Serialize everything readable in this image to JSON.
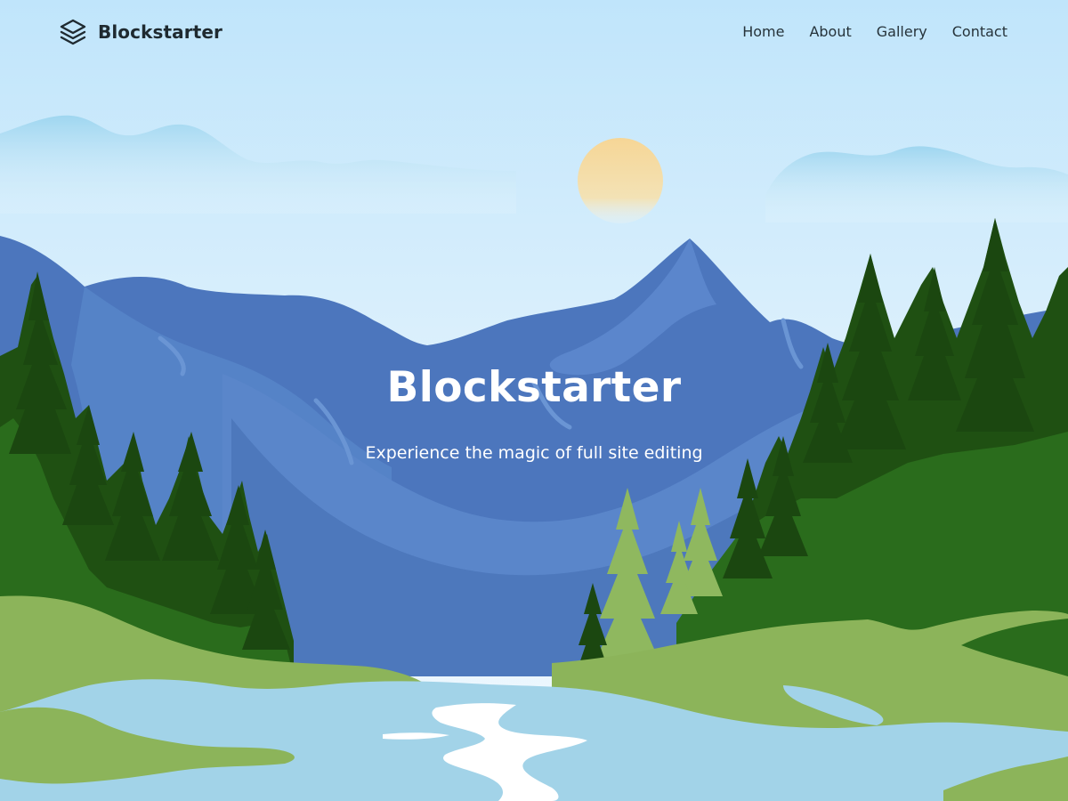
{
  "site": {
    "name": "Blockstarter",
    "logo_icon": "stacked-layers-icon"
  },
  "nav": {
    "items": [
      {
        "label": "Home"
      },
      {
        "label": "About"
      },
      {
        "label": "Gallery"
      },
      {
        "label": "Contact"
      }
    ]
  },
  "hero": {
    "title": "Blockstarter",
    "subtitle": "Experience the magic of full site editing",
    "illustration": "mountain-lake-forest-landscape"
  },
  "colors": {
    "sky_top": "#c1e6fb",
    "sky_bottom": "#e9f6fd",
    "sun": "#f5d79a",
    "mountain": "#4e79bf",
    "mountain_light": "#5c87cb",
    "forest_dark": "#1e4f12",
    "forest_mid": "#2a6b1d",
    "grass": "#8cb45a",
    "tree_light": "#8fb85f",
    "water": "#a2d3e8",
    "water_highlight": "#ffffff",
    "text_dark": "#1f2a30",
    "text_light": "#ffffff"
  }
}
